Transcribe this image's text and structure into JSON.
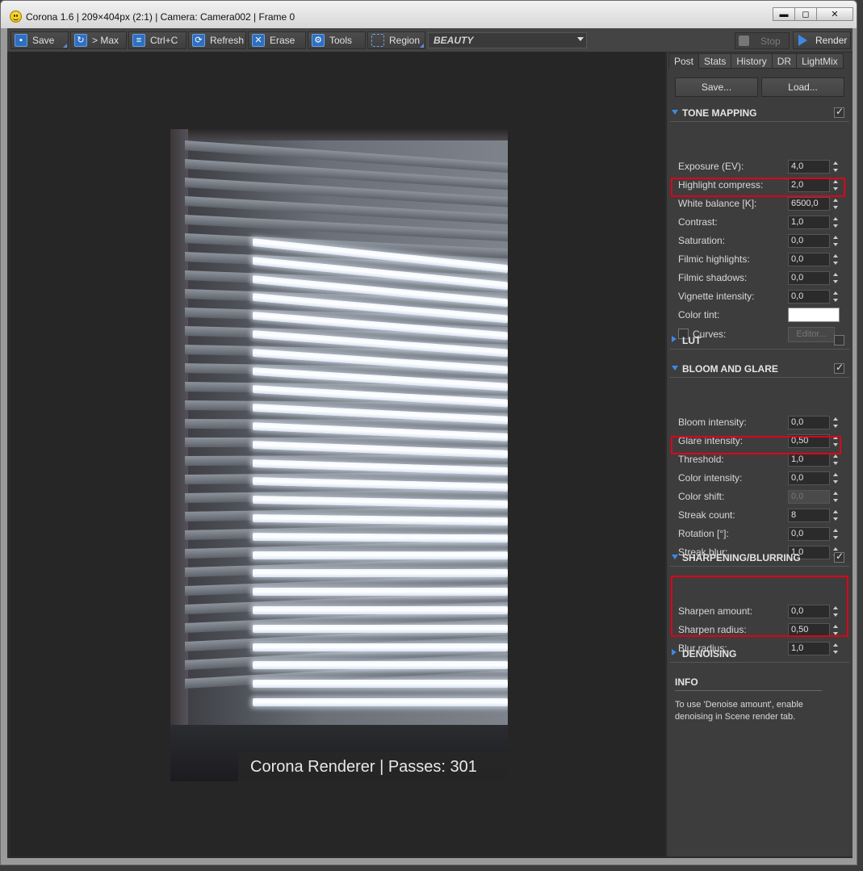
{
  "window": {
    "title": "Corona 1.6 | 209×404px (2:1) | Camera: Camera002 | Frame 0",
    "minimize": "▬",
    "maximize": "◻",
    "close": "✕"
  },
  "toolbar": {
    "save": "Save",
    "max": "> Max",
    "copy": "Ctrl+C",
    "refresh": "Refresh",
    "erase": "Erase",
    "tools": "Tools",
    "region": "Region",
    "channel": "BEAUTY",
    "stop": "Stop",
    "render": "Render"
  },
  "viewport": {
    "watermark": "Corona Renderer | Passes: 301"
  },
  "panel": {
    "tabs": [
      "Post",
      "Stats",
      "History",
      "DR",
      "LightMix"
    ],
    "save_btn": "Save...",
    "load_btn": "Load...",
    "tone_mapping": {
      "title": "TONE MAPPING",
      "rows": [
        {
          "label": "Exposure (EV):",
          "value": "4,0"
        },
        {
          "label": "Highlight compress:",
          "value": "2,0"
        },
        {
          "label": "White balance [K]:",
          "value": "6500,0"
        },
        {
          "label": "Contrast:",
          "value": "1,0"
        },
        {
          "label": "Saturation:",
          "value": "0,0"
        },
        {
          "label": "Filmic highlights:",
          "value": "0,0"
        },
        {
          "label": "Filmic shadows:",
          "value": "0,0"
        },
        {
          "label": "Vignette intensity:",
          "value": "0,0"
        }
      ],
      "color_tint": "Color tint:",
      "curves": "Curves:",
      "editor": "Editor..."
    },
    "lut": {
      "title": "LUT"
    },
    "bloom_glare": {
      "title": "BLOOM AND GLARE",
      "rows": [
        {
          "label": "Bloom intensity:",
          "value": "0,0"
        },
        {
          "label": "Glare intensity:",
          "value": "0,50"
        },
        {
          "label": "Threshold:",
          "value": "1,0"
        },
        {
          "label": "Color intensity:",
          "value": "0,0"
        },
        {
          "label": "Color shift:",
          "value": "0,0"
        },
        {
          "label": "Streak count:",
          "value": "8"
        },
        {
          "label": "Rotation [°]:",
          "value": "0,0"
        },
        {
          "label": "Streak blur:",
          "value": "1,0"
        }
      ]
    },
    "sharpening": {
      "title": "SHARPENING/BLURRING",
      "rows": [
        {
          "label": "Sharpen amount:",
          "value": "0,0"
        },
        {
          "label": "Sharpen radius:",
          "value": "0,50"
        },
        {
          "label": "Blur radius:",
          "value": "1,0"
        }
      ]
    },
    "denoising": {
      "title": "DENOISING"
    },
    "info": {
      "title": "INFO",
      "text": "To use 'Denoise amount', enable denoising in Scene render tab."
    }
  },
  "colors": {
    "highlight": "#e0001a",
    "accent": "#3b8ae6"
  }
}
